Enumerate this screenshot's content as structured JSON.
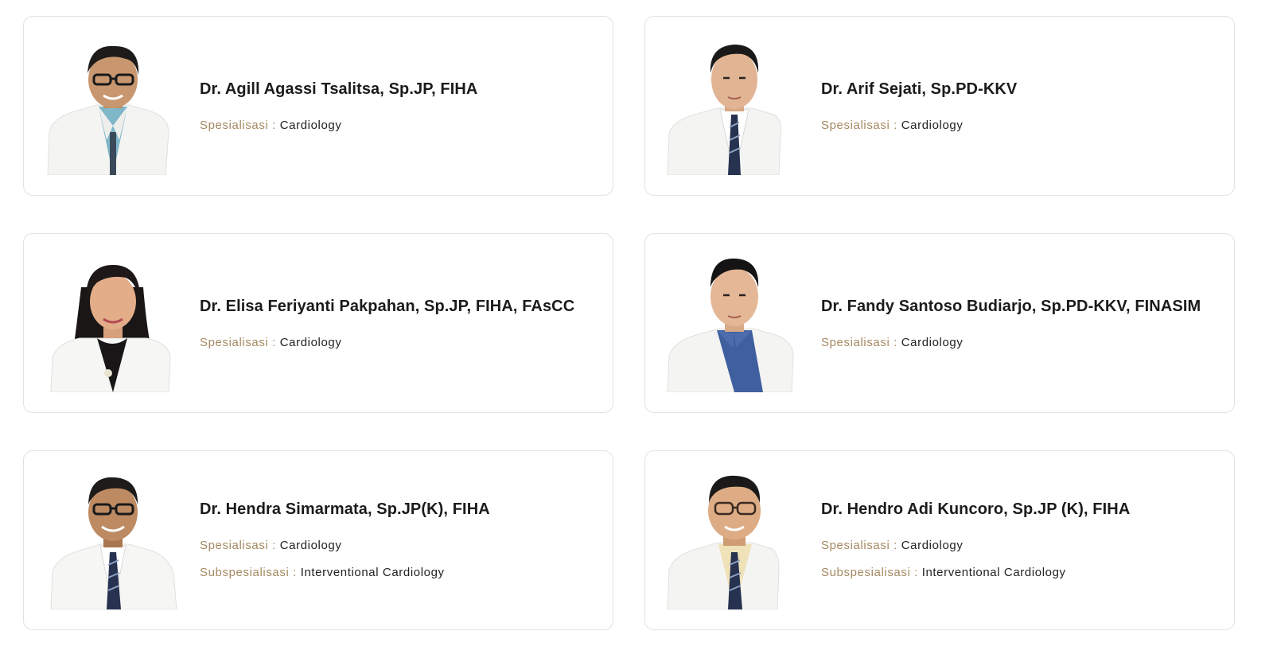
{
  "colors": {
    "label": "#a58a62",
    "name": "#1b1b1b",
    "card_border": "#e2e2e2"
  },
  "label_separator": " : ",
  "doctors": [
    {
      "name": "Dr. Agill Agassi Tsalitsa, Sp.JP, FIHA",
      "specialization_label": "Spesialisasi",
      "specialization": "Cardiology"
    },
    {
      "name": "Dr. Arif Sejati, Sp.PD-KKV",
      "specialization_label": "Spesialisasi",
      "specialization": "Cardiology"
    },
    {
      "name": "Dr. Elisa Feriyanti Pakpahan, Sp.JP, FIHA, FAsCC",
      "specialization_label": "Spesialisasi",
      "specialization": "Cardiology"
    },
    {
      "name": "Dr. Fandy Santoso Budiarjo, Sp.PD-KKV, FINASIM",
      "specialization_label": "Spesialisasi",
      "specialization": "Cardiology"
    },
    {
      "name": "Dr. Hendra Simarmata, Sp.JP(K), FIHA",
      "specialization_label": "Spesialisasi",
      "specialization": "Cardiology",
      "subspecialization_label": "Subspesialisasi",
      "subspecialization": "Interventional Cardiology"
    },
    {
      "name": "Dr. Hendro Adi Kuncoro, Sp.JP (K), FIHA",
      "specialization_label": "Spesialisasi",
      "specialization": "Cardiology",
      "subspecialization_label": "Subspesialisasi",
      "subspecialization": "Interventional Cardiology"
    }
  ]
}
